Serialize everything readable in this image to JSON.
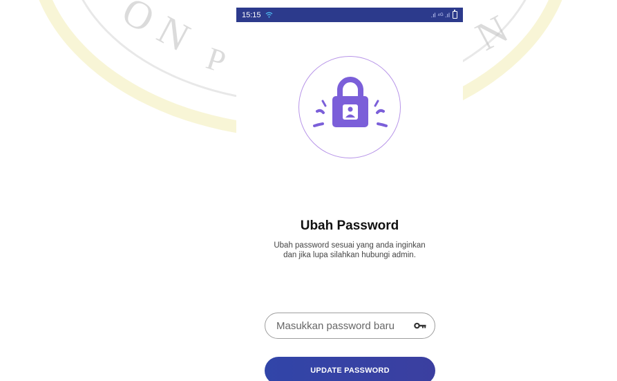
{
  "status_bar": {
    "time": "15:15",
    "signal_text": ".ıl ⁴ᴳ .ıl"
  },
  "page": {
    "title": "Ubah Password",
    "subtitle": "Ubah password sesuai yang anda inginkan dan jika lupa silahkan hubungi admin."
  },
  "form": {
    "password_placeholder": "Masukkan password baru",
    "password_value": "",
    "submit_label": "UPDATE PASSWORD"
  },
  "watermark": {
    "left_text": "ON",
    "left_text_2": "P",
    "right_text": "N"
  },
  "colors": {
    "status_bar": "#2c3a8c",
    "lock": "#7b5fd9",
    "circle_border": "#b794e8",
    "button": "#3145a8"
  }
}
